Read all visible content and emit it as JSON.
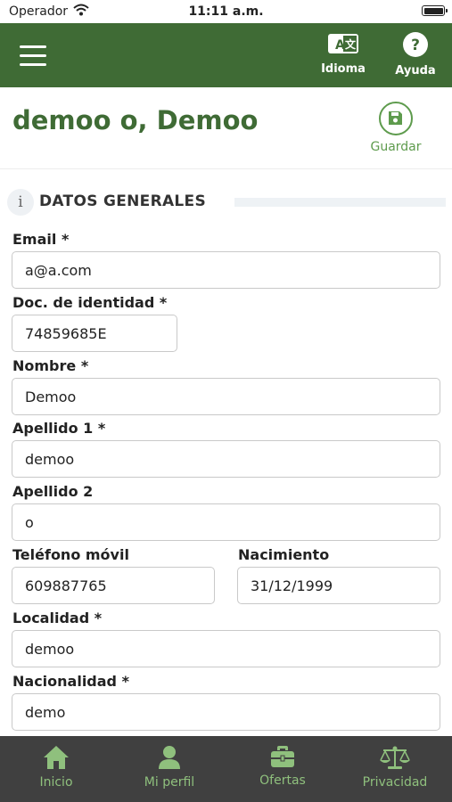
{
  "status_bar": {
    "carrier": "Operador",
    "time": "11:11 a.m."
  },
  "header": {
    "menu_icon": "hamburger-menu-icon",
    "language_label": "Idioma",
    "language_icon": "translate-icon",
    "help_label": "Ayuda",
    "help_icon": "help-circle-icon",
    "background_color": "#3f6b35"
  },
  "title_bar": {
    "title": "demoo o, Demoo",
    "save_label": "Guardar",
    "save_icon": "floppy-disk-icon",
    "accent_color": "#5e9b4d"
  },
  "section": {
    "title": "DATOS GENERALES",
    "icon": "info-icon"
  },
  "form": {
    "email": {
      "label": "Email *",
      "value": "a@a.com"
    },
    "doc_id": {
      "label": "Doc. de identidad *",
      "value": "74859685E"
    },
    "nombre": {
      "label": "Nombre *",
      "value": "Demoo"
    },
    "apellido1": {
      "label": "Apellido 1 *",
      "value": "demoo"
    },
    "apellido2": {
      "label": "Apellido 2",
      "value": "o"
    },
    "telefono": {
      "label": "Teléfono móvil",
      "value": "609887765"
    },
    "nacimiento": {
      "label": "Nacimiento",
      "value": "31/12/1999"
    },
    "localidad": {
      "label": "Localidad *",
      "value": "demoo"
    },
    "nacionalidad": {
      "label": "Nacionalidad *",
      "value": "demo"
    }
  },
  "tab_bar": {
    "tabs": [
      {
        "label": "Inicio",
        "icon": "home-icon"
      },
      {
        "label": "Mi perfil",
        "icon": "user-icon"
      },
      {
        "label": "Ofertas",
        "icon": "briefcase-icon"
      },
      {
        "label": "Privacidad",
        "icon": "balance-scale-icon"
      }
    ],
    "tab_color": "#8fc07d"
  }
}
